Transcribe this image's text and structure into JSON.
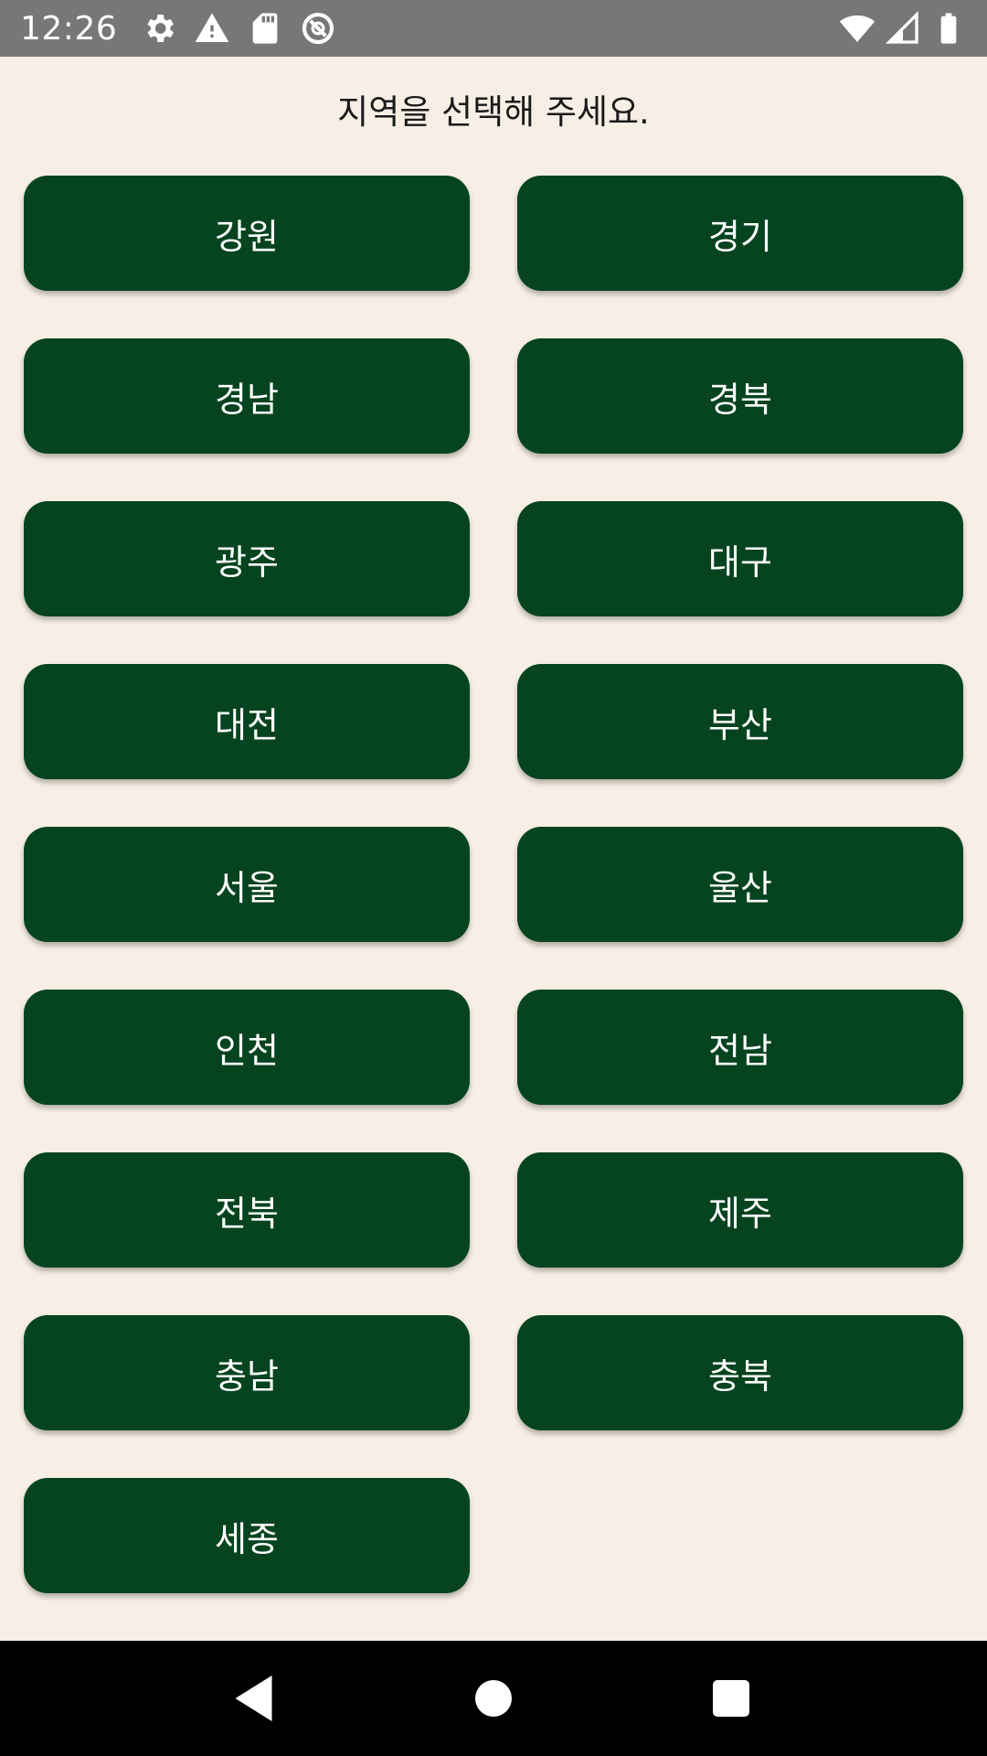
{
  "status_bar": {
    "time": "12:26",
    "left_icons": [
      "settings-icon",
      "warning-icon",
      "sd-card-icon",
      "no-disturb-icon"
    ],
    "right_icons": [
      "wifi-icon",
      "signal-icon",
      "battery-icon"
    ]
  },
  "prompt": "지역을 선택해 주세요.",
  "regions": [
    "강원",
    "경기",
    "경남",
    "경북",
    "광주",
    "대구",
    "대전",
    "부산",
    "서울",
    "울산",
    "인천",
    "전남",
    "전북",
    "제주",
    "충남",
    "충북",
    "세종"
  ],
  "colors": {
    "background": "#f7efe5",
    "button": "#064420",
    "button_text": "#ffffff",
    "status_bar": "#777777",
    "nav_bar": "#000000"
  },
  "nav_bar": {
    "buttons": [
      "back-icon",
      "home-icon",
      "recents-icon"
    ]
  }
}
